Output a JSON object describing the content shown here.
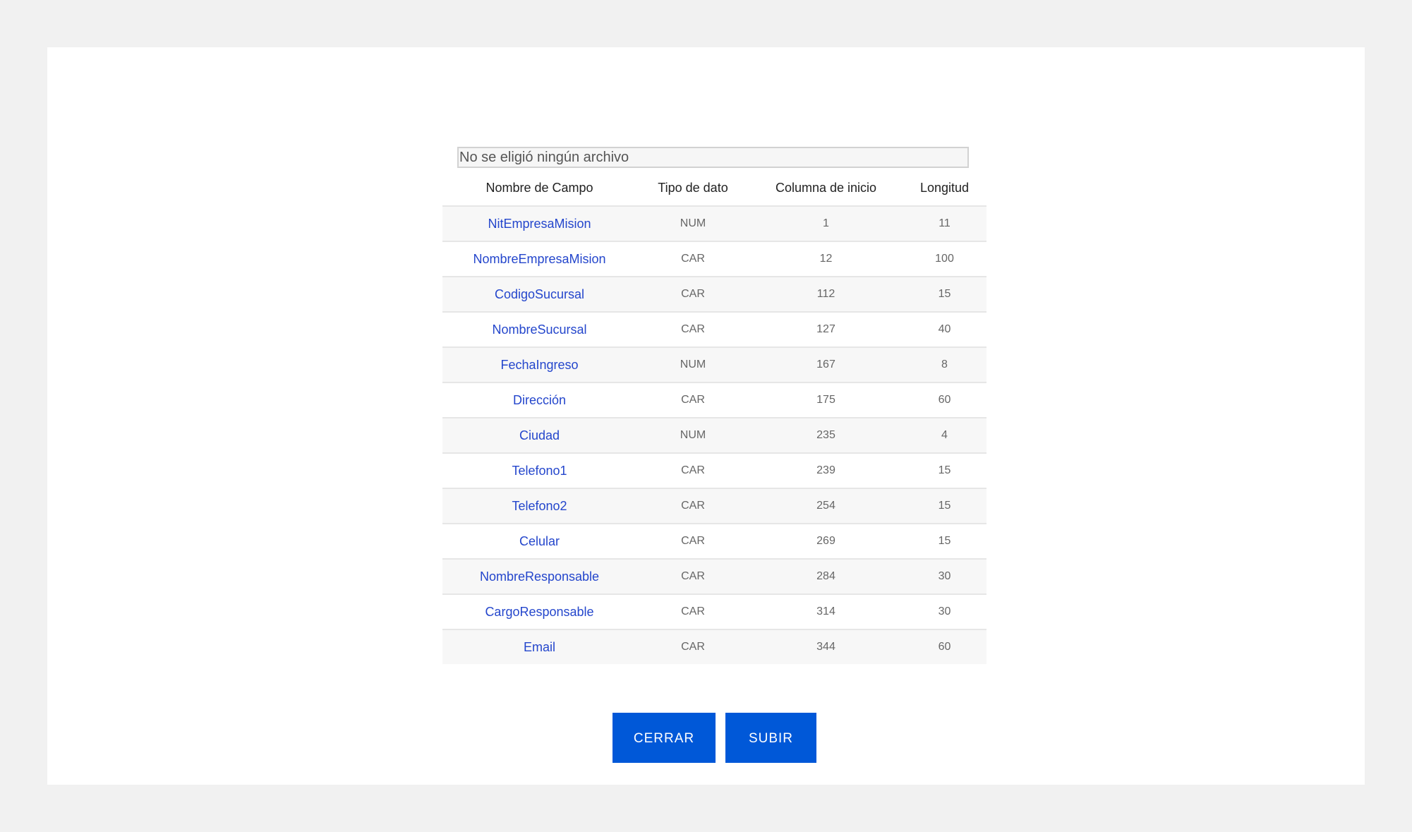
{
  "file_input": {
    "status_text": "No se eligió ningún archivo"
  },
  "table": {
    "headers": [
      "Nombre de Campo",
      "Tipo de dato",
      "Columna de inicio",
      "Longitud"
    ],
    "rows": [
      {
        "nombre": "NitEmpresaMision",
        "tipo": "NUM",
        "inicio": "1",
        "longitud": "11"
      },
      {
        "nombre": "NombreEmpresaMision",
        "tipo": "CAR",
        "inicio": "12",
        "longitud": "100"
      },
      {
        "nombre": "CodigoSucursal",
        "tipo": "CAR",
        "inicio": "112",
        "longitud": "15"
      },
      {
        "nombre": "NombreSucursal",
        "tipo": "CAR",
        "inicio": "127",
        "longitud": "40"
      },
      {
        "nombre": "FechaIngreso",
        "tipo": "NUM",
        "inicio": "167",
        "longitud": "8"
      },
      {
        "nombre": "Dirección",
        "tipo": "CAR",
        "inicio": "175",
        "longitud": "60"
      },
      {
        "nombre": "Ciudad",
        "tipo": "NUM",
        "inicio": "235",
        "longitud": "4"
      },
      {
        "nombre": "Telefono1",
        "tipo": "CAR",
        "inicio": "239",
        "longitud": "15"
      },
      {
        "nombre": "Telefono2",
        "tipo": "CAR",
        "inicio": "254",
        "longitud": "15"
      },
      {
        "nombre": "Celular",
        "tipo": "CAR",
        "inicio": "269",
        "longitud": "15"
      },
      {
        "nombre": "NombreResponsable",
        "tipo": "CAR",
        "inicio": "284",
        "longitud": "30"
      },
      {
        "nombre": "CargoResponsable",
        "tipo": "CAR",
        "inicio": "314",
        "longitud": "30"
      },
      {
        "nombre": "Email",
        "tipo": "CAR",
        "inicio": "344",
        "longitud": "60"
      }
    ]
  },
  "buttons": {
    "cerrar_label": "CERRAR",
    "subir_label": "SUBIR"
  },
  "colors": {
    "primary_button": "#0058d8",
    "field_name_text": "#2446cc"
  }
}
